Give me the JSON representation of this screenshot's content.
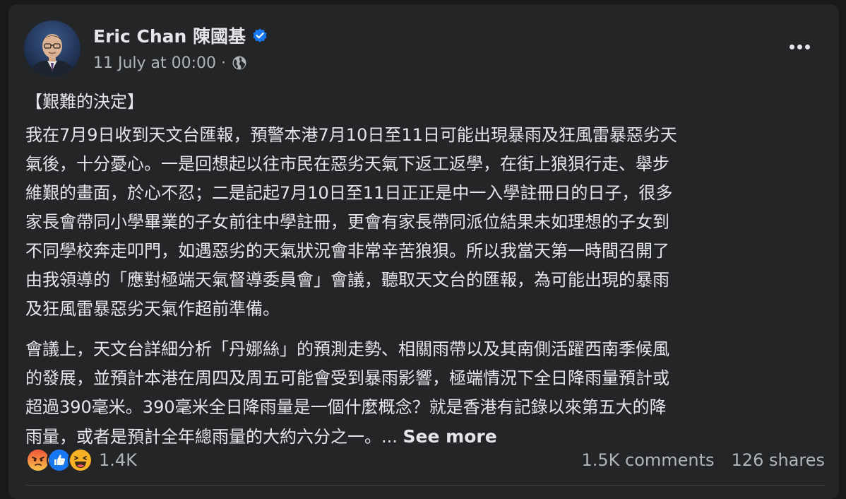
{
  "post": {
    "author": "Eric Chan 陳國基",
    "timestamp": "11 July at 00:00 ·",
    "audience_icon": "globe-icon",
    "verified_icon": "verified-badge-icon",
    "menu_icon": "more-options-icon",
    "title": "【艱難的決定】",
    "paragraph1": [
      "我在7月9日收到天文台匯報，預警本港7月10日至11日可能出現暴雨及狂風雷暴惡劣天",
      "氣後，十分憂心。一是回想起以往市民在惡劣天氣下返工返學，在街上狼狽行走、舉步",
      "維艱的畫面，於心不忍；二是記起7月10日至11日正正是中一入學註冊日的日子，很多",
      "家長會帶同小學畢業的子女前往中學註冊，更會有家長帶同派位結果未如理想的子女到",
      "不同學校奔走叩門，如遇惡劣的天氣狀況會非常辛苦狼狽。所以我當天第一時間召開了",
      "由我領導的「應對極端天氣督導委員會」會議，聽取天文台的匯報，為可能出現的暴雨",
      "及狂風雷暴惡劣天氣作超前準備。"
    ],
    "paragraph2": [
      "會議上，天文台詳細分析「丹娜絲」的預測走勢、相關雨帶以及其南側活躍西南季候風",
      "的發展，並預計本港在周四及周五可能會受到暴雨影響，極端情況下全日降雨量預計或",
      "超過390毫米。390毫米全日降雨量是一個什麼概念？就是香港有記錄以來第五大的降"
    ],
    "paragraph2_last": "雨量，或者是預計全年總雨量的大約六分之一。...",
    "see_more": "See more",
    "reactions": {
      "icons": [
        "angry-reaction-icon",
        "like-reaction-icon",
        "haha-reaction-icon"
      ],
      "count": "1.4K"
    },
    "comments": "1.5K comments",
    "shares": "126 shares"
  },
  "colors": {
    "page_background": "#18191a",
    "card_background": "#242526",
    "primary_text": "#e4e6eb",
    "secondary_text": "#b0b3b8",
    "verified_blue": "#1877f2",
    "like_blue": "#1877f2",
    "angry_red": "#e9710f",
    "haha_yellow": "#f7b125"
  }
}
